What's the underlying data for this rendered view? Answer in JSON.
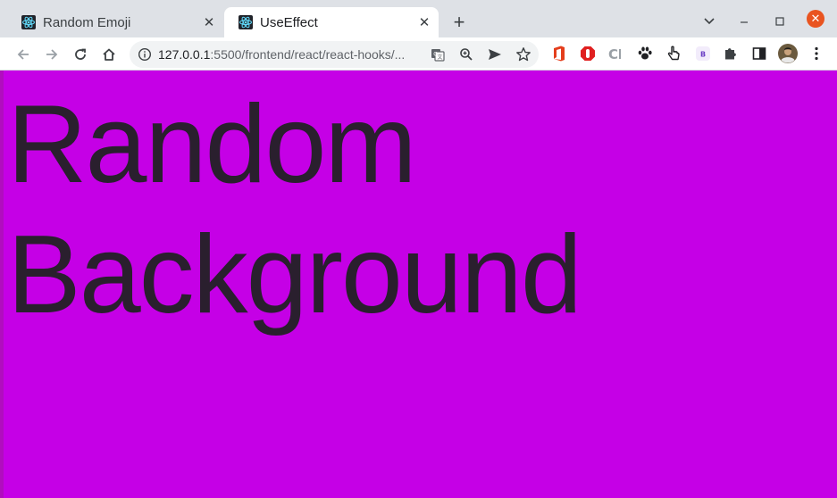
{
  "browser": {
    "tabs": [
      {
        "title": "Random Emoji",
        "favicon": "react-icon",
        "active": false
      },
      {
        "title": "UseEffect",
        "favicon": "react-icon",
        "active": true
      }
    ],
    "url_host": "127.0.0.1",
    "url_path": ":5500/frontend/react/react-hooks/...",
    "colors": {
      "tabstrip": "#dee1e6",
      "close_button": "#e95420"
    }
  },
  "page": {
    "heading": "Random Background",
    "background_color": "#c500e6",
    "text_color": "#2a1f2e"
  }
}
